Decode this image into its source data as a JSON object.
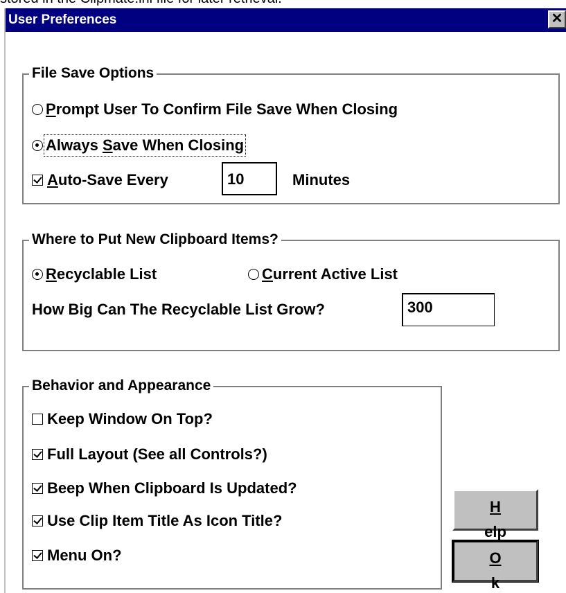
{
  "page_caption": "stored in the Clipmate.ini file for later retrieval.",
  "window": {
    "title": "User Preferences",
    "close_symbol": "✕"
  },
  "file_save": {
    "group_label": "File Save Options",
    "prompt": {
      "pre": "",
      "key": "P",
      "post": "rompt User To Confirm File Save When Closing",
      "selected": false
    },
    "always": {
      "pre": "Always ",
      "key": "S",
      "post": "ave When Closing",
      "selected": true
    },
    "autosave": {
      "pre": "",
      "key": "A",
      "post": "uto-Save Every",
      "checked": true
    },
    "autosave_value": "10",
    "autosave_unit": "Minutes"
  },
  "clipboard": {
    "group_label": "Where to Put New Clipboard Items?",
    "recyclable": {
      "key": "R",
      "post": "ecyclable List",
      "selected": true
    },
    "current": {
      "key": "C",
      "post": "urrent Active List",
      "selected": false
    },
    "grow_label": "How Big Can The Recyclable List Grow?",
    "grow_value": "300"
  },
  "behavior": {
    "group_label": "Behavior and Appearance",
    "items": [
      {
        "label": "Keep Window On Top?",
        "checked": false
      },
      {
        "label": "Full Layout (See all Controls?)",
        "checked": true
      },
      {
        "label": "Beep When Clipboard Is Updated?",
        "checked": true
      },
      {
        "label": "Use Clip Item Title As Icon Title?",
        "checked": true
      },
      {
        "label": "Menu On?",
        "checked": true
      }
    ]
  },
  "buttons": {
    "help": {
      "key": "H",
      "rest": "elp"
    },
    "ok": {
      "key": "O",
      "rest": "k"
    }
  }
}
